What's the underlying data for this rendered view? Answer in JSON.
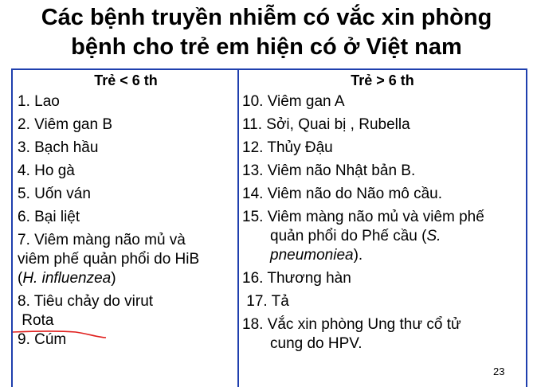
{
  "title": {
    "line1": "Các bệnh truyền nhiễm có vắc xin phòng",
    "line2": "bệnh cho trẻ em hiện có ở Việt nam"
  },
  "table": {
    "left": {
      "header": "Trẻ < 6 th",
      "items": [
        "1. Lao",
        "2. Viêm gan B",
        "3. Bạch hầu",
        "4. Ho gà",
        "5. Uốn ván",
        "6. Bại liệt"
      ],
      "item7": {
        "line1": "7. Viêm màng não mủ và",
        "line2": "viêm phế quản phổi do HiB",
        "line3_pre": "(",
        "line3_italic": "H. influenzea",
        "line3_post": ")"
      },
      "item8": {
        "line1": "8. Tiêu chảy do virut",
        "line2": " Rota"
      },
      "item9": "9. Cúm"
    },
    "right": {
      "header": "Trẻ > 6 th",
      "items": [
        "10. Viêm gan A",
        "11. Sởi,  Quai bị , Rubella",
        "12. Thủy Đậu",
        "13. Viêm não Nhật bản B.",
        "14. Viêm não do Não mô  cầu."
      ],
      "item15": {
        "line1": "15. Viêm màng não mủ và   viêm phế",
        "line2_pre": "quản phổi do Phế  cầu (",
        "line2_italic": "S.",
        "line3_italic": "pneumoniea",
        "line3_post": ")."
      },
      "item16": "16. Thương hàn",
      "item17": " 17. Tả",
      "item18": {
        "line1": "18.  Vắc xin phòng Ung thư cổ tử",
        "line2": "cung do HPV."
      }
    }
  },
  "page_number": "23",
  "colors": {
    "border": "#1f3fae",
    "annotation": "#e0201e"
  }
}
